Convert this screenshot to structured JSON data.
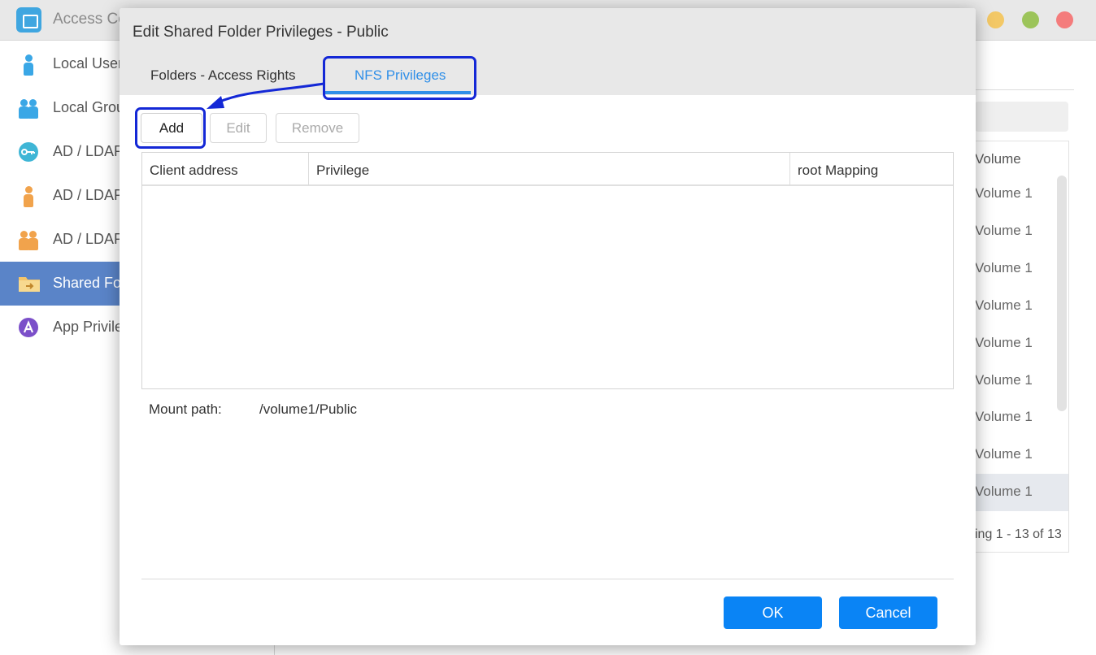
{
  "background_app": {
    "title": "Access Co",
    "window_controls": [
      "minimize",
      "maximize",
      "close"
    ],
    "sidebar": {
      "items": [
        {
          "label": "Local User",
          "icon": "user-icon",
          "active": false
        },
        {
          "label": "Local Grou",
          "icon": "group-icon",
          "active": false
        },
        {
          "label": "AD / LDAP",
          "icon": "key-icon",
          "active": false
        },
        {
          "label": "AD / LDAP",
          "icon": "user-icon",
          "active": false
        },
        {
          "label": "AD / LDAP",
          "icon": "group-icon",
          "active": false
        },
        {
          "label": "Shared Fo",
          "icon": "folder-icon",
          "active": true
        },
        {
          "label": "App Privile",
          "icon": "app-icon",
          "active": false
        }
      ]
    },
    "table": {
      "column_header": "Volume",
      "rows": [
        "Volume 1",
        "Volume 1",
        "Volume 1",
        "Volume 1",
        "Volume 1",
        "Volume 1",
        "Volume 1",
        "Volume 1",
        "Volume 1"
      ],
      "selected_row": 8,
      "footer": "ing 1 - 13 of 13"
    }
  },
  "dialog": {
    "title": "Edit Shared Folder Privileges - Public",
    "tabs": [
      {
        "label": "Folders - Access Rights",
        "active": false
      },
      {
        "label": "NFS Privileges",
        "active": true
      }
    ],
    "toolbar": {
      "add_label": "Add",
      "edit_label": "Edit",
      "remove_label": "Remove"
    },
    "grid": {
      "columns": [
        "Client address",
        "Privilege",
        "root Mapping"
      ],
      "rows": []
    },
    "mount_path": {
      "label": "Mount path:",
      "value": "/volume1/Public"
    },
    "buttons": {
      "ok_label": "OK",
      "cancel_label": "Cancel"
    }
  },
  "colors": {
    "accent": "#2f8fe8",
    "primary_button": "#0a84f5",
    "sidebar_active": "#5a84c8",
    "annotation": "#1428d6"
  }
}
